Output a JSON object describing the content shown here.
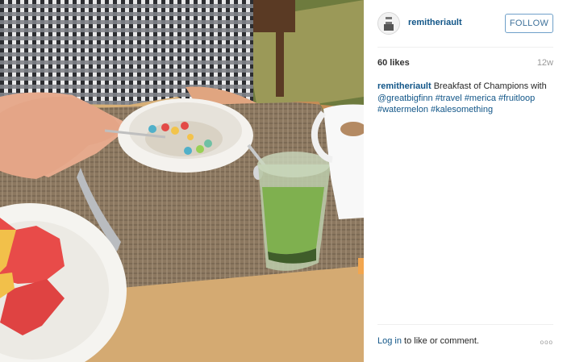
{
  "post": {
    "username": "remitheriault",
    "follow_label": "FOLLOW",
    "likes": "60 likes",
    "age": "12w",
    "caption_user": "remitheriault",
    "caption_text": "Breakfast of Champions with",
    "mention": "@greatbigfinn",
    "tags": [
      "#travel",
      "#merica",
      "#fruitloop",
      "#watermelon",
      "#kalesomething"
    ],
    "login_link": "Log in",
    "login_rest": "to like or comment.",
    "more_label": "ooo"
  }
}
